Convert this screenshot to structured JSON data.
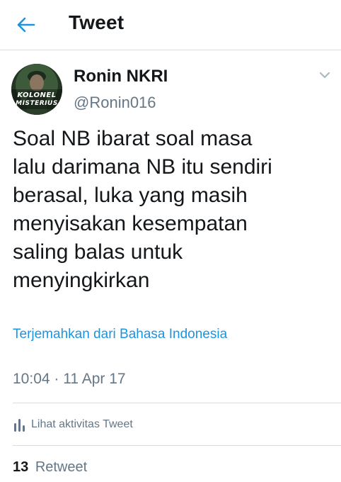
{
  "header": {
    "title": "Tweet"
  },
  "author": {
    "name": "Ronin NKRI",
    "handle": "@Ronin016",
    "avatar_text_line1": "KOLONEL",
    "avatar_text_line2": "MISTERIUS"
  },
  "tweet": {
    "text": "Soal NB ibarat soal masa\nlalu darimana NB itu sendiri\nberasal, luka yang masih\nmenyisakan kesempatan\nsaling balas untuk\nmenyingkirkan",
    "translate_label": "Terjemahkan dari Bahasa Indonesia",
    "timestamp": "10:04 · 11 Apr 17"
  },
  "activity": {
    "label": "Lihat aktivitas Tweet"
  },
  "stats": {
    "retweet_count": "13",
    "retweet_label": "Retweet"
  },
  "colors": {
    "accent": "#1b95e0",
    "muted": "#657786",
    "text": "#14171a",
    "divider": "#d8dde2"
  },
  "icons": {
    "back": "arrow-left-icon",
    "menu": "chevron-down-icon",
    "activity": "bar-chart-icon"
  }
}
